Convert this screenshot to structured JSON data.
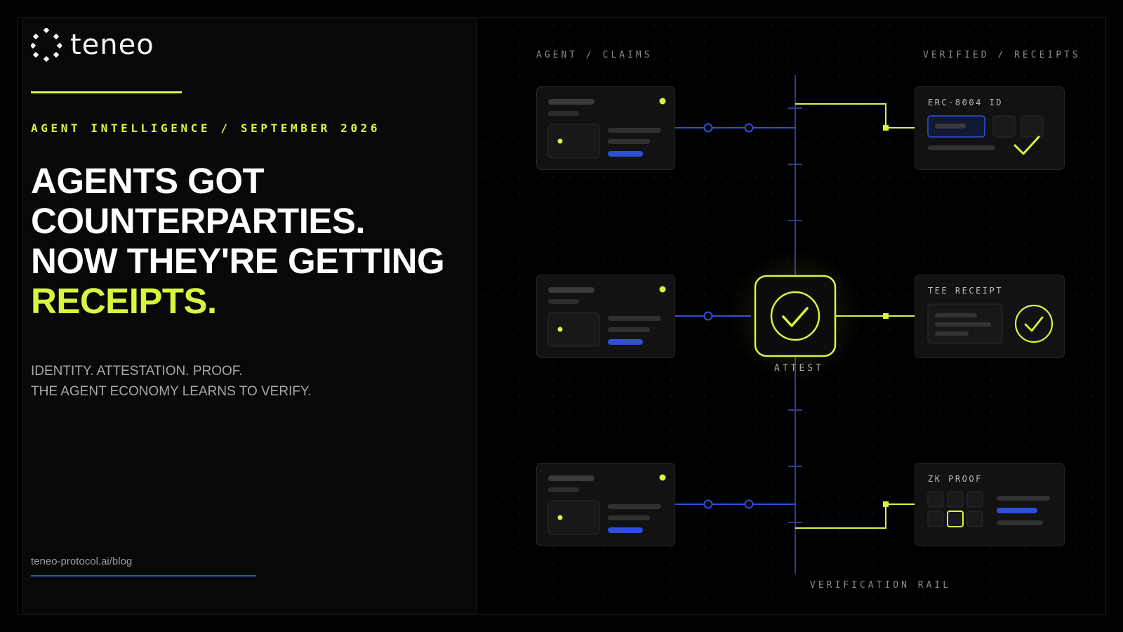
{
  "brand": {
    "name": "teneo"
  },
  "hero": {
    "eyebrow": "AGENT INTELLIGENCE / SEPTEMBER 2026",
    "headline_line1": "AGENTS GOT",
    "headline_line2": "COUNTERPARTIES.",
    "headline_line3": "NOW THEY'RE GETTING",
    "headline_highlight": "RECEIPTS.",
    "sub_line1": "IDENTITY. ATTESTATION. PROOF.",
    "sub_line2": "THE AGENT ECONOMY LEARNS TO VERIFY.",
    "url": "teneo-protocol.ai/blog"
  },
  "diagram": {
    "left_column_label": "AGENT / CLAIMS",
    "right_column_label": "VERIFIED / RECEIPTS",
    "center_label": "ATTEST",
    "rail_label": "VERIFICATION RAIL",
    "receipts": [
      {
        "title": "ERC-8004 ID"
      },
      {
        "title": "TEE RECEIPT"
      },
      {
        "title": "ZK PROOF"
      }
    ]
  },
  "colors": {
    "accent_lime": "#d8f540",
    "accent_blue": "#2e4fd8",
    "background": "#000000",
    "panel": "#080808",
    "card": "#121212"
  }
}
